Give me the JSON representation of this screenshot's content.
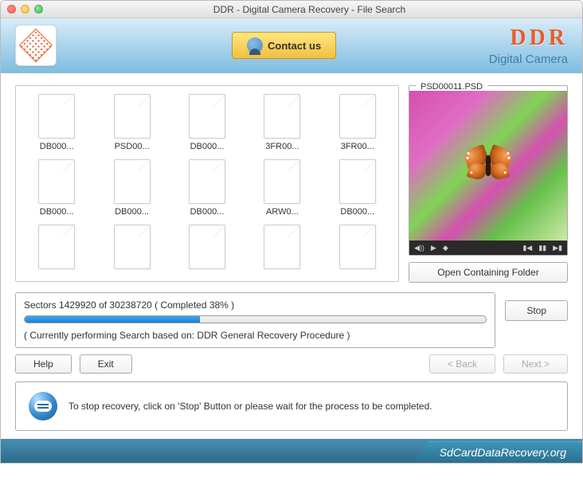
{
  "window": {
    "title": "DDR - Digital Camera Recovery - File Search"
  },
  "header": {
    "contact": "Contact us",
    "brand": "DDR",
    "brand_sub": "Digital Camera"
  },
  "files": [
    {
      "name": "DB000..."
    },
    {
      "name": "PSD00..."
    },
    {
      "name": "DB000..."
    },
    {
      "name": "3FR00..."
    },
    {
      "name": "3FR00..."
    },
    {
      "name": "DB000..."
    },
    {
      "name": "DB000..."
    },
    {
      "name": "DB000..."
    },
    {
      "name": "ARW0..."
    },
    {
      "name": "DB000..."
    },
    {
      "name": ""
    },
    {
      "name": ""
    },
    {
      "name": ""
    },
    {
      "name": ""
    },
    {
      "name": ""
    }
  ],
  "preview": {
    "filename": "PSD00011.PSD"
  },
  "buttons": {
    "open_folder": "Open Containing Folder",
    "stop": "Stop",
    "help": "Help",
    "exit": "Exit",
    "back": "< Back",
    "next": "Next >"
  },
  "progress": {
    "sectors_done": "1429920",
    "sectors_total": "30238720",
    "percent": 38,
    "text": "Sectors 1429920 of 30238720   ( Completed  38% )",
    "status": "( Currently performing Search based on: DDR General Recovery Procedure )"
  },
  "info": {
    "text": "To stop recovery, click on 'Stop' Button or please wait for the process to be completed."
  },
  "footer": {
    "site": "SdCardDataRecovery.org"
  },
  "media": {
    "vol": "◀))",
    "play": "▶",
    "pos": "◆",
    "prev": "▮◀",
    "pause": "▮▮",
    "next": "▶▮"
  }
}
